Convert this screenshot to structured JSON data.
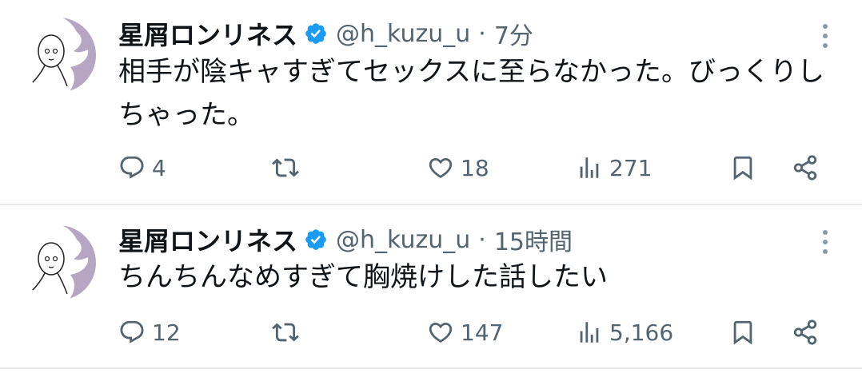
{
  "tweets": [
    {
      "author": {
        "display_name": "星屑ロンリネス",
        "handle": "@h_kuzu_u",
        "verified": true
      },
      "separator": "·",
      "time": "7分",
      "text": "相手が陰キャすぎてセックスに至らなかった。びっくりしちゃった。",
      "metrics": {
        "replies": "4",
        "retweets": "",
        "likes": "18",
        "views": "271"
      }
    },
    {
      "author": {
        "display_name": "星屑ロンリネス",
        "handle": "@h_kuzu_u",
        "verified": true
      },
      "separator": "·",
      "time": "15時間",
      "text": "ちんちんなめすぎて胸焼けした話したい",
      "metrics": {
        "replies": "12",
        "retweets": "",
        "likes": "147",
        "views": "5,166"
      }
    }
  ],
  "icons": {
    "avatar": "hand-drawn-character-avatar",
    "verified": "verified-badge-icon",
    "more": "more-vertical-icon",
    "reply": "reply-bubble-icon",
    "retweet": "retweet-icon",
    "like": "heart-icon",
    "views": "bar-chart-icon",
    "bookmark": "bookmark-icon",
    "share": "share-icon"
  },
  "colors": {
    "text_primary": "#0f1419",
    "text_secondary": "#536471",
    "verified_blue": "#1d9bf0",
    "divider": "#e7e9ea",
    "avatar_purple": "#b7a6c3"
  }
}
